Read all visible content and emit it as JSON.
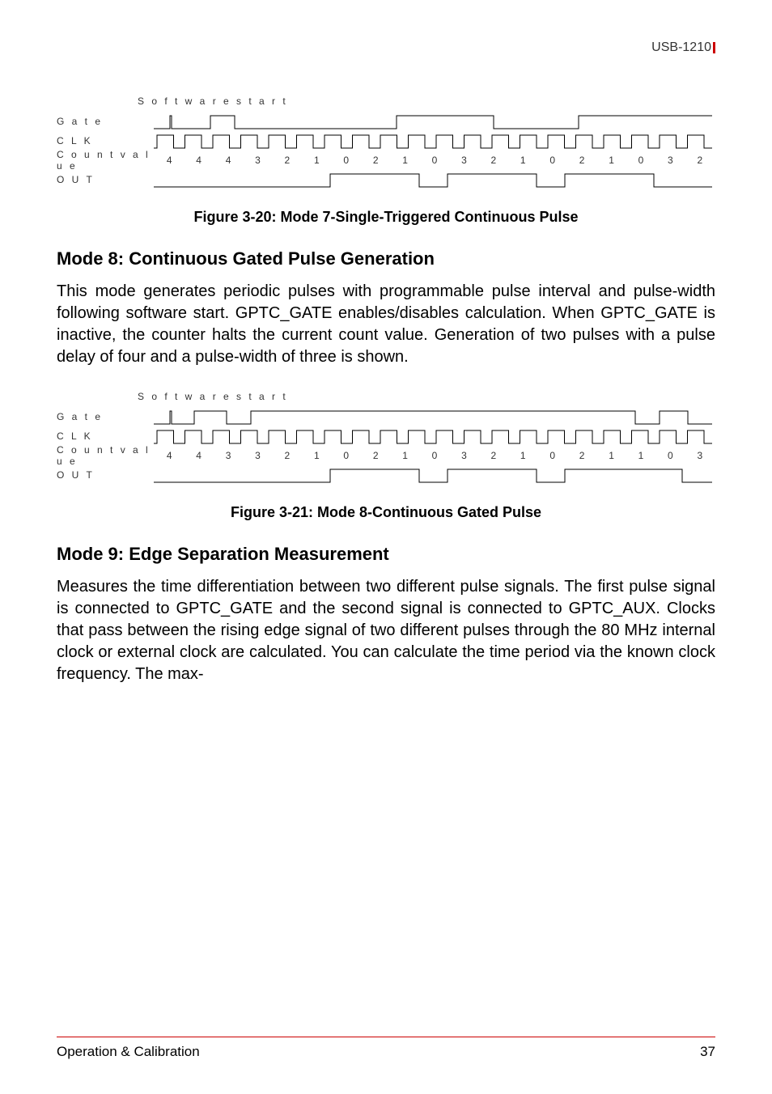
{
  "header": {
    "model": "USB-1210"
  },
  "fig1": {
    "softstart": "S o f t w a r e  s t a r t",
    "gate": "G a t e",
    "clk": "C L K",
    "countlabel": "C o u n t  v a l u e",
    "outlabel": "O U T",
    "caption": "Figure 3-20: Mode 7-Single-Triggered Continuous Pulse",
    "counts": [
      "4",
      "4",
      "4",
      "3",
      "2",
      "1",
      "0",
      "2",
      "1",
      "0",
      "3",
      "2",
      "1",
      "0",
      "2",
      "1",
      "0",
      "3",
      "2"
    ]
  },
  "mode8": {
    "title": "Mode 8: Continuous Gated Pulse Generation",
    "text": "This mode generates periodic pulses with programmable pulse interval and pulse-width following software start. GPTC_GATE enables/disables calculation. When GPTC_GATE is inactive, the counter halts the current count value. Generation of two pulses with a pulse delay of four and a pulse-width of three is shown."
  },
  "fig2": {
    "softstart": "S o f t w a r e  s t a r t",
    "gate": "G a t e",
    "clk": "C L K",
    "countlabel": "C o u n t  v a l u e",
    "outlabel": "O U T",
    "caption": "Figure 3-21: Mode 8-Continuous Gated Pulse",
    "counts": [
      "4",
      "4",
      "3",
      "3",
      "2",
      "1",
      "0",
      "2",
      "1",
      "0",
      "3",
      "2",
      "1",
      "0",
      "2",
      "1",
      "1",
      "0",
      "3"
    ]
  },
  "mode9": {
    "title": "Mode 9: Edge Separation Measurement",
    "text": "Measures the time differentiation between two different pulse signals. The first pulse signal is connected to GPTC_GATE and the second signal is connected to GPTC_AUX. Clocks that pass between the rising edge signal of two different pulses through the 80 MHz internal clock or external clock are calculated. You can calculate the time period via the known clock frequency. The max-"
  },
  "footer": {
    "left": "Operation & Calibration",
    "right": "37"
  },
  "chart_data": [
    {
      "type": "timing",
      "title": "Mode 7 – Single-Triggered Continuous Pulse",
      "signals": {
        "SoftwareStart": "rising edge near start",
        "Gate": "low, brief high pulse near start, low, mid-length high, low, long high, low",
        "CLK": "continuous clock, ~20 rising edges",
        "CountValue": [
          4,
          4,
          4,
          3,
          2,
          1,
          0,
          2,
          1,
          0,
          3,
          2,
          1,
          0,
          2,
          1,
          0,
          3,
          2
        ],
        "OUT": "low then pulses high for counts 2-1-0 windows"
      }
    },
    {
      "type": "timing",
      "title": "Mode 8 – Continuous Gated Pulse",
      "signals": {
        "SoftwareStart": "rising edge near start",
        "Gate": "low, high, briefly low, long high, low+high near end",
        "CLK": "continuous clock, ~20 rising edges",
        "CountValue": [
          4,
          4,
          3,
          3,
          2,
          1,
          0,
          2,
          1,
          0,
          3,
          2,
          1,
          0,
          2,
          1,
          1,
          0,
          3
        ],
        "OUT": "low then high during 2-1-0 windows, repeated"
      }
    }
  ]
}
